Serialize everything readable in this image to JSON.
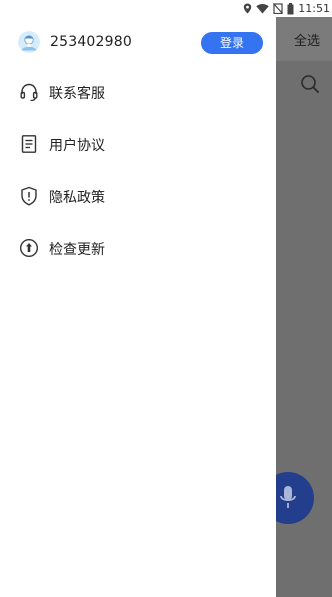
{
  "status_bar": {
    "time": "11:51",
    "icons": [
      "location-icon",
      "wifi-icon",
      "no-sim-icon",
      "battery-icon"
    ]
  },
  "drawer": {
    "user": {
      "id": "253402980",
      "login_label": "登录",
      "avatar_icon": "user-avatar-icon"
    },
    "menu": [
      {
        "label": "联系客服",
        "icon": "headset-icon"
      },
      {
        "label": "用户协议",
        "icon": "document-icon"
      },
      {
        "label": "隐私政策",
        "icon": "shield-icon"
      },
      {
        "label": "检查更新",
        "icon": "update-icon"
      }
    ]
  },
  "background_app": {
    "select_all_label": "全选",
    "search_icon": "search-icon",
    "fab_icon": "microphone-icon"
  },
  "colors": {
    "accent": "#3574f0",
    "fab": "#223e8c",
    "overlay": "#6f6f6f"
  }
}
